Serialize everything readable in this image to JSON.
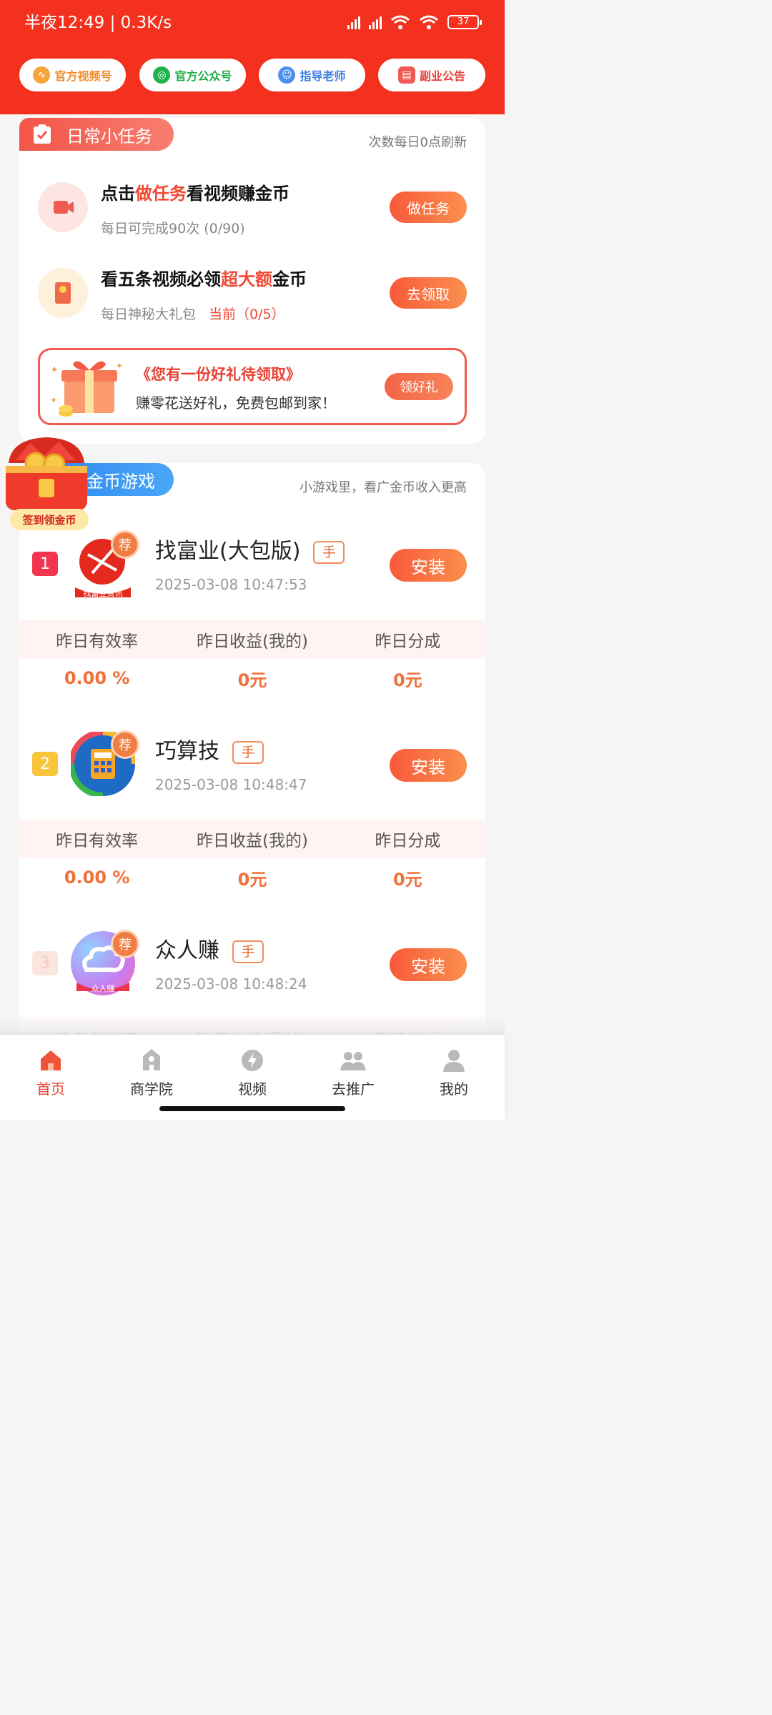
{
  "status_bar": {
    "time": "半夜12:49 | 0.3K/s",
    "battery": "37"
  },
  "top_pills": [
    {
      "label": "官方视频号",
      "icon": "video-channel-icon",
      "color": "#f08c2c"
    },
    {
      "label": "官方公众号",
      "icon": "wechat-official-icon",
      "color": "#1fb04a"
    },
    {
      "label": "指导老师",
      "icon": "teacher-avatar-icon",
      "color": "#3b7fe2"
    },
    {
      "label": "副业公告",
      "icon": "announcement-icon",
      "color": "#e8413a"
    }
  ],
  "daily_tasks": {
    "tag": "日常小任务",
    "note": "次数每日0点刷新",
    "tasks": [
      {
        "title_pre": "点击",
        "title_hl": "做任务",
        "title_post": "看视频赚金币",
        "sub": "每日可完成90次 (0/90)",
        "sub_hl": "",
        "button": "做任务"
      },
      {
        "title_pre": "看五条视频必领",
        "title_hl": "超大额",
        "title_post": "金币",
        "sub": "每日神秘大礼包",
        "sub_hl": "当前（0/5）",
        "button": "去领取"
      }
    ],
    "gift": {
      "title": "《您有一份好礼待领取》",
      "desc": "赚零花送好礼，免费包邮到家！",
      "button": "领好礼"
    }
  },
  "floating_badge": "签到领金币",
  "coin_games": {
    "tag": "金币游戏",
    "note": "小游戏里，看广金币收入更高",
    "stat_headers": [
      "昨日有效率",
      "昨日收益(我的)",
      "昨日分成"
    ],
    "games": [
      {
        "rank": "1",
        "name": "找富业(大包版)",
        "tag": "手",
        "recommend": "荐",
        "date": "2025-03-08 10:47:53",
        "button": "安装",
        "stats": [
          "0.00 %",
          "0元",
          "0元"
        ],
        "icon_caption": "找富业资讯"
      },
      {
        "rank": "2",
        "name": "巧算技",
        "tag": "手",
        "recommend": "荐",
        "date": "2025-03-08 10:48:47",
        "button": "安装",
        "stats": [
          "0.00 %",
          "0元",
          "0元"
        ]
      },
      {
        "rank": "3",
        "name": "众人赚",
        "tag": "手",
        "recommend": "荐",
        "date": "2025-03-08 10:48:24",
        "button": "安装",
        "icon_caption": "众人赚"
      }
    ]
  },
  "tab_bar": [
    {
      "label": "首页",
      "icon": "home-icon",
      "active": true
    },
    {
      "label": "商学院",
      "icon": "school-icon",
      "active": false
    },
    {
      "label": "视频",
      "icon": "video-icon",
      "active": false
    },
    {
      "label": "去推广",
      "icon": "promote-icon",
      "active": false
    },
    {
      "label": "我的",
      "icon": "profile-icon",
      "active": false
    }
  ],
  "colors": {
    "brand_red": "#f4311e",
    "accent_orange": "#fb8f4e",
    "active_tab": "#e8412e"
  }
}
